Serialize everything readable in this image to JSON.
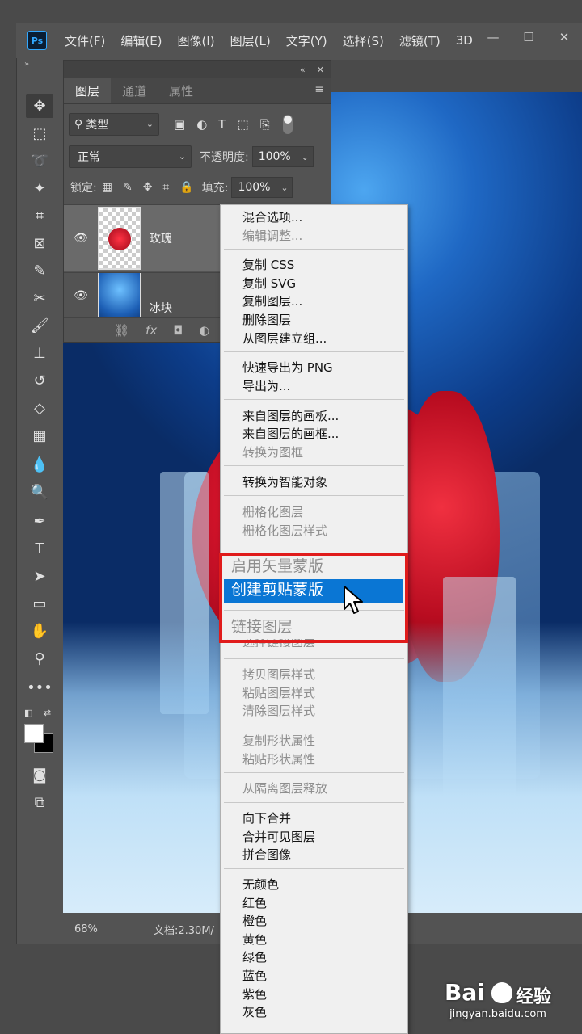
{
  "menubar": {
    "logo": "Ps",
    "items": [
      "文件(F)",
      "编辑(E)",
      "图像(I)",
      "图层(L)",
      "文字(Y)",
      "选择(S)",
      "滤镜(T)",
      "3D"
    ],
    "win_controls": [
      "—",
      "☐",
      "✕"
    ]
  },
  "layers_panel": {
    "tabs": [
      "图层",
      "通道",
      "属性"
    ],
    "filter_kind": "类型",
    "blend_mode": "正常",
    "opacity_label": "不透明度:",
    "opacity_value": "100%",
    "lock_label": "锁定:",
    "fill_label": "填充:",
    "fill_value": "100%",
    "layers": [
      {
        "name": "玫瑰",
        "selected": true
      },
      {
        "name": "冰块",
        "selected": false
      }
    ]
  },
  "statusbar": {
    "zoom": "68%",
    "doc": "文档:2.30M/"
  },
  "context_menu": {
    "groups": [
      [
        {
          "label": "混合选项...",
          "enabled": true
        },
        {
          "label": "编辑调整...",
          "enabled": false
        }
      ],
      [
        {
          "label": "复制 CSS",
          "enabled": true
        },
        {
          "label": "复制 SVG",
          "enabled": true
        },
        {
          "label": "复制图层...",
          "enabled": true
        },
        {
          "label": "删除图层",
          "enabled": true
        },
        {
          "label": "从图层建立组...",
          "enabled": true
        }
      ],
      [
        {
          "label": "快速导出为 PNG",
          "enabled": true
        },
        {
          "label": "导出为...",
          "enabled": true
        }
      ],
      [
        {
          "label": "来自图层的画板...",
          "enabled": true
        },
        {
          "label": "来自图层的画框...",
          "enabled": true
        },
        {
          "label": "转换为图框",
          "enabled": false
        }
      ],
      [
        {
          "label": "转换为智能对象",
          "enabled": true
        }
      ],
      [
        {
          "label": "栅格化图层",
          "enabled": false
        },
        {
          "label": "栅格化图层样式",
          "enabled": false
        }
      ],
      [
        {
          "label": "启用矢量蒙版",
          "enabled": false
        },
        {
          "label": "创建剪贴蒙版",
          "enabled": true,
          "highlighted": true
        }
      ],
      [
        {
          "label": "链接图层",
          "enabled": false
        },
        {
          "label": "选择链接图层",
          "enabled": false
        }
      ],
      [
        {
          "label": "拷贝图层样式",
          "enabled": false
        },
        {
          "label": "粘贴图层样式",
          "enabled": false
        },
        {
          "label": "清除图层样式",
          "enabled": false
        }
      ],
      [
        {
          "label": "复制形状属性",
          "enabled": false
        },
        {
          "label": "粘贴形状属性",
          "enabled": false
        }
      ],
      [
        {
          "label": "从隔离图层释放",
          "enabled": false
        }
      ],
      [
        {
          "label": "向下合并",
          "enabled": true
        },
        {
          "label": "合并可见图层",
          "enabled": true
        },
        {
          "label": "拼合图像",
          "enabled": true
        }
      ],
      [
        {
          "label": "无颜色",
          "enabled": true
        },
        {
          "label": "红色",
          "enabled": true
        },
        {
          "label": "橙色",
          "enabled": true
        },
        {
          "label": "黄色",
          "enabled": true
        },
        {
          "label": "绿色",
          "enabled": true
        },
        {
          "label": "蓝色",
          "enabled": true
        },
        {
          "label": "紫色",
          "enabled": true
        },
        {
          "label": "灰色",
          "enabled": true
        }
      ]
    ]
  },
  "watermark": {
    "brand": "Bai",
    "product": "经验",
    "url": "jingyan.baidu.com"
  },
  "colors": {
    "highlight": "#0a76d4",
    "annotation_box": "#e01b1b",
    "app_bg": "#535353"
  }
}
